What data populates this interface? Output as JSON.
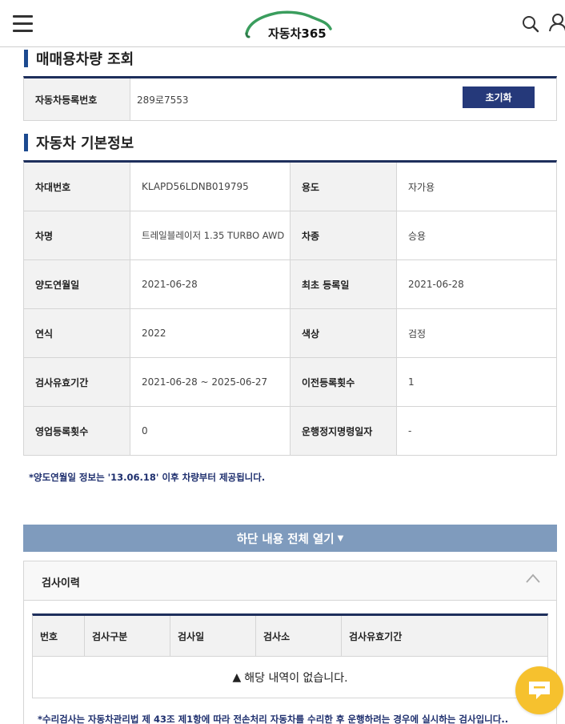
{
  "header": {
    "logo_text": "자동차365",
    "menu_icon": "hamburger-menu-icon",
    "search_icon": "search-icon",
    "user_icon": "user-icon"
  },
  "lookup": {
    "title": "매매용차량 조회",
    "reg_label": "자동차등록번호",
    "reg_value": "289로7553",
    "reset_label": "초기화"
  },
  "basic_info": {
    "title": "자동차 기본정보",
    "rows": [
      {
        "l1": "차대번호",
        "v1": "KLAPD56LDNB019795",
        "l2": "용도",
        "v2": "자가용"
      },
      {
        "l1": "차명",
        "v1": "트레일블레이저 1.35 TURBO AWD",
        "l2": "차종",
        "v2": "승용"
      },
      {
        "l1": "양도연월일",
        "v1": "2021-06-28",
        "l2": "최초 등록일",
        "v2": "2021-06-28"
      },
      {
        "l1": "연식",
        "v1": "2022",
        "l2": "색상",
        "v2": "검정"
      },
      {
        "l1": "검사유효기간",
        "v1": "2021-06-28 ~ 2025-06-27",
        "l2": "이전등록횟수",
        "v2": "1"
      },
      {
        "l1": "영업등록횟수",
        "v1": "0",
        "l2": "운행정지명령일자",
        "v2": "-"
      }
    ],
    "note": "*양도연월일 정보는 '13.06.18' 이후 차량부터 제공됩니다."
  },
  "expand": {
    "label": "하단 내용 전체 열기",
    "arrow": "▼"
  },
  "inspection": {
    "title": "검사이력",
    "columns": [
      "번호",
      "검사구분",
      "검사일",
      "검사소",
      "검사유효기간"
    ],
    "empty_text": "해당 내역이 없습니다.",
    "warn_glyph": "▲",
    "note": "*수리검사는 자동차관리법 제 43조 제1항에 따라 전손처리 자동차를 수리한 후 운행하려는 경우에 실시하는 검사입니다.."
  },
  "colors": {
    "accent": "#1c4a8f",
    "button": "#25397a",
    "expand_bar": "#7f9bbd",
    "chat": "#f6c12e"
  }
}
